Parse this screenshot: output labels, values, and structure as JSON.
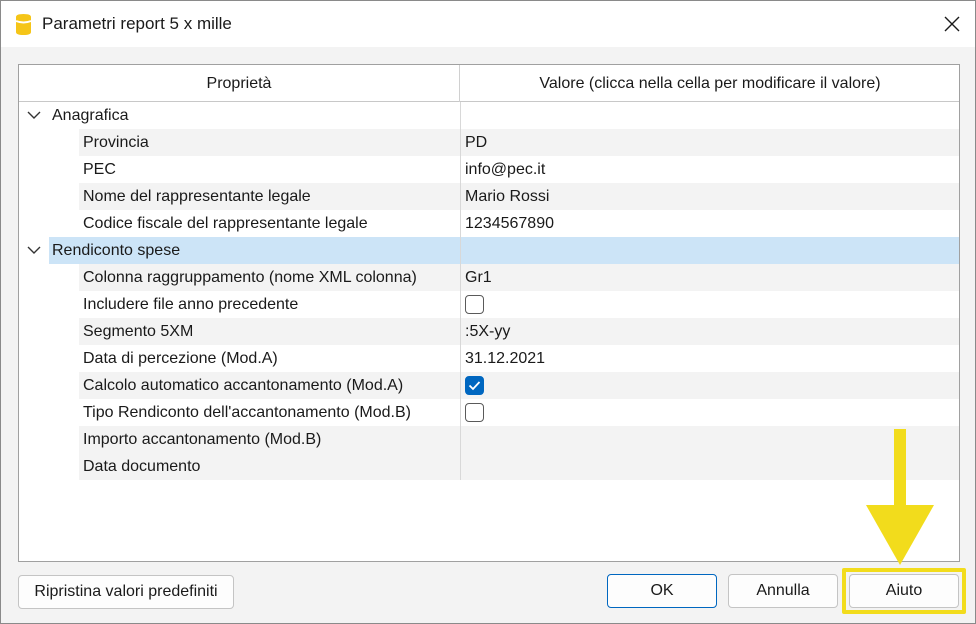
{
  "window": {
    "title": "Parametri report 5 x mille",
    "app_icon": "banana-app-icon",
    "close_icon": "close-icon"
  },
  "grid": {
    "header": {
      "property": "Proprietà",
      "value": "Valore (clicca nella cella per modificare il valore)"
    },
    "groups": [
      {
        "label": "Anagrafica",
        "expanded": true,
        "rows": [
          {
            "label": "Provincia",
            "value": "PD"
          },
          {
            "label": "PEC",
            "value": "info@pec.it"
          },
          {
            "label": "Nome del rappresentante legale",
            "value": "Mario Rossi"
          },
          {
            "label": "Codice fiscale del rappresentante legale",
            "value": "1234567890"
          }
        ]
      },
      {
        "label": "Rendiconto spese",
        "expanded": true,
        "selected": true,
        "rows": [
          {
            "label": "Colonna raggruppamento (nome XML colonna)",
            "value": "Gr1"
          },
          {
            "label": "Includere file anno precedente",
            "checkbox": false
          },
          {
            "label": "Segmento 5XM",
            "value": ":5X-yy"
          },
          {
            "label": "Data di percezione (Mod.A)",
            "value": "31.12.2021"
          },
          {
            "label": "Calcolo automatico accantonamento (Mod.A)",
            "checkbox": true
          },
          {
            "label": "Tipo Rendiconto dell'accantonamento (Mod.B)",
            "checkbox": false
          },
          {
            "label": "Importo accantonamento (Mod.B)",
            "value": ""
          },
          {
            "label": "Data documento",
            "value": ""
          }
        ]
      }
    ]
  },
  "buttons": {
    "reset": "Ripristina valori predefiniti",
    "ok": "OK",
    "cancel": "Annulla",
    "help": "Aiuto"
  },
  "annotation": {
    "highlight_color": "#f2dc1c",
    "icon": "arrow-down-icon"
  },
  "colors": {
    "accent": "#0067c0",
    "selection": "#cce4f7"
  }
}
